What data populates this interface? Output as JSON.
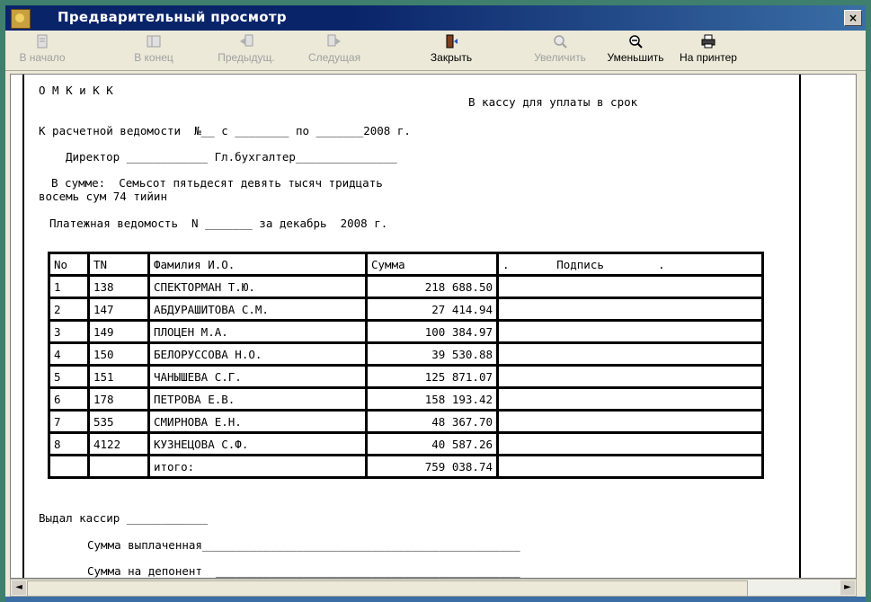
{
  "window": {
    "title": "Предварительный просмотр",
    "close_label": "×"
  },
  "toolbar": {
    "first": "В начало",
    "last": "В конец",
    "prev": "Предыдущ.",
    "next": "Следущая",
    "close": "Закрыть",
    "zoom_in": "Увеличить",
    "zoom_out": "Уменьшить",
    "print": "На принтер"
  },
  "doc": {
    "org": "О М К и К К",
    "to_cash": "В кассу для уплаты в срок",
    "statement_line": "К расчетной ведомости  №__ с ________ по _______2008 г.",
    "director_line": "Директор ____________ Гл.бухгалтер_______________",
    "sum_line1": "В сумме:  Семьсот пятьдесят девять тысяч тридцать",
    "sum_line2": "восемь сум 74 тийин",
    "payroll_line": "Платежная ведомость  N _______ за декабрь  2008 г.",
    "table": {
      "headers": [
        "No",
        "TN",
        "Фамилия И.О.",
        "Сумма",
        ".       Подпись        ."
      ],
      "rows": [
        [
          "1",
          "138",
          "СПЕКТОРМАН Т.Ю.",
          "218 688.50"
        ],
        [
          "2",
          "147",
          "АБДУРАШИТОВА С.М.",
          "27 414.94"
        ],
        [
          "3",
          "149",
          "ПЛОЦЕН М.А.",
          "100 384.97"
        ],
        [
          "4",
          "150",
          "БЕЛОРУССОВА Н.О.",
          "39 530.88"
        ],
        [
          "5",
          "151",
          "ЧАНЫШЕВА С.Г.",
          "125 871.07"
        ],
        [
          "6",
          "178",
          "ПЕТРОВА Е.В.",
          "158 193.42"
        ],
        [
          "7",
          "535",
          "СМИРНОВА Е.Н.",
          "48 367.70"
        ],
        [
          "8",
          "4122",
          "КУЗНЕЦОВА С.Ф.",
          "40 587.26"
        ]
      ],
      "total_label": "итого:",
      "total_value": "759 038.74"
    },
    "cashier_line": "Выдал кассир ____________",
    "paid_line": "Сумма выплаченная_______________________________________________",
    "deposit_line": "Сумма на депонент  _____________________________________________"
  },
  "colors": {
    "title_bar": "#0a246a",
    "desktop": "#3f7f6d",
    "toolbar_bg": "#ece9d8"
  }
}
